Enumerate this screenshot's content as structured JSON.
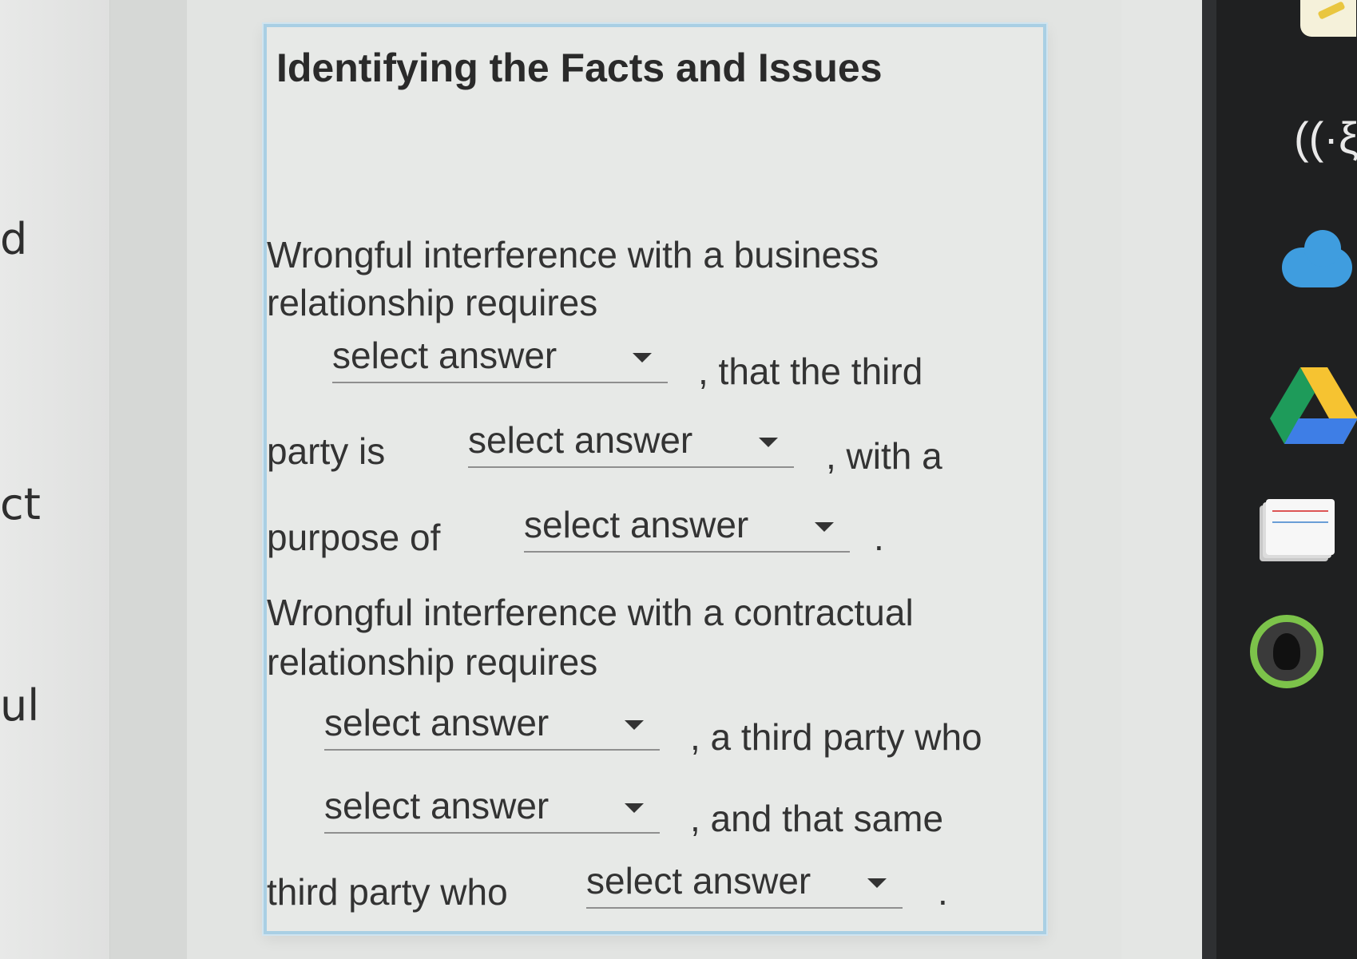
{
  "left_page": {
    "edge_chars": [
      "d",
      "ct",
      "ul"
    ]
  },
  "card": {
    "title": "Identifying the Facts and Issues",
    "business": {
      "line1": "Wrongful interference with a business",
      "line2": "relationship requires",
      "dropdown1": "select answer",
      "after1": ", that the third",
      "before2": "party is",
      "dropdown2": "select answer",
      "after2": ", with a",
      "before3": "purpose of",
      "dropdown3": "select answer",
      "after3": "."
    },
    "contractual": {
      "line1": "Wrongful interference with a contractual",
      "line2": "relationship requires",
      "dropdown1": "select answer",
      "after1": ", a third party who",
      "dropdown2": "select answer",
      "after2": ", and that same",
      "before3": "third party who",
      "dropdown3": "select answer",
      "after3": "."
    }
  },
  "rail_icons": [
    "pencil-icon",
    "read-aloud-icon",
    "onedrive-icon",
    "google-drive-icon",
    "notecards-icon",
    "profile-ring-icon"
  ],
  "colors": {
    "card_border": "#a9cfe4",
    "rail": "#1f2021",
    "cloud": "#3f9ddf",
    "ring": "#7cc34a"
  }
}
